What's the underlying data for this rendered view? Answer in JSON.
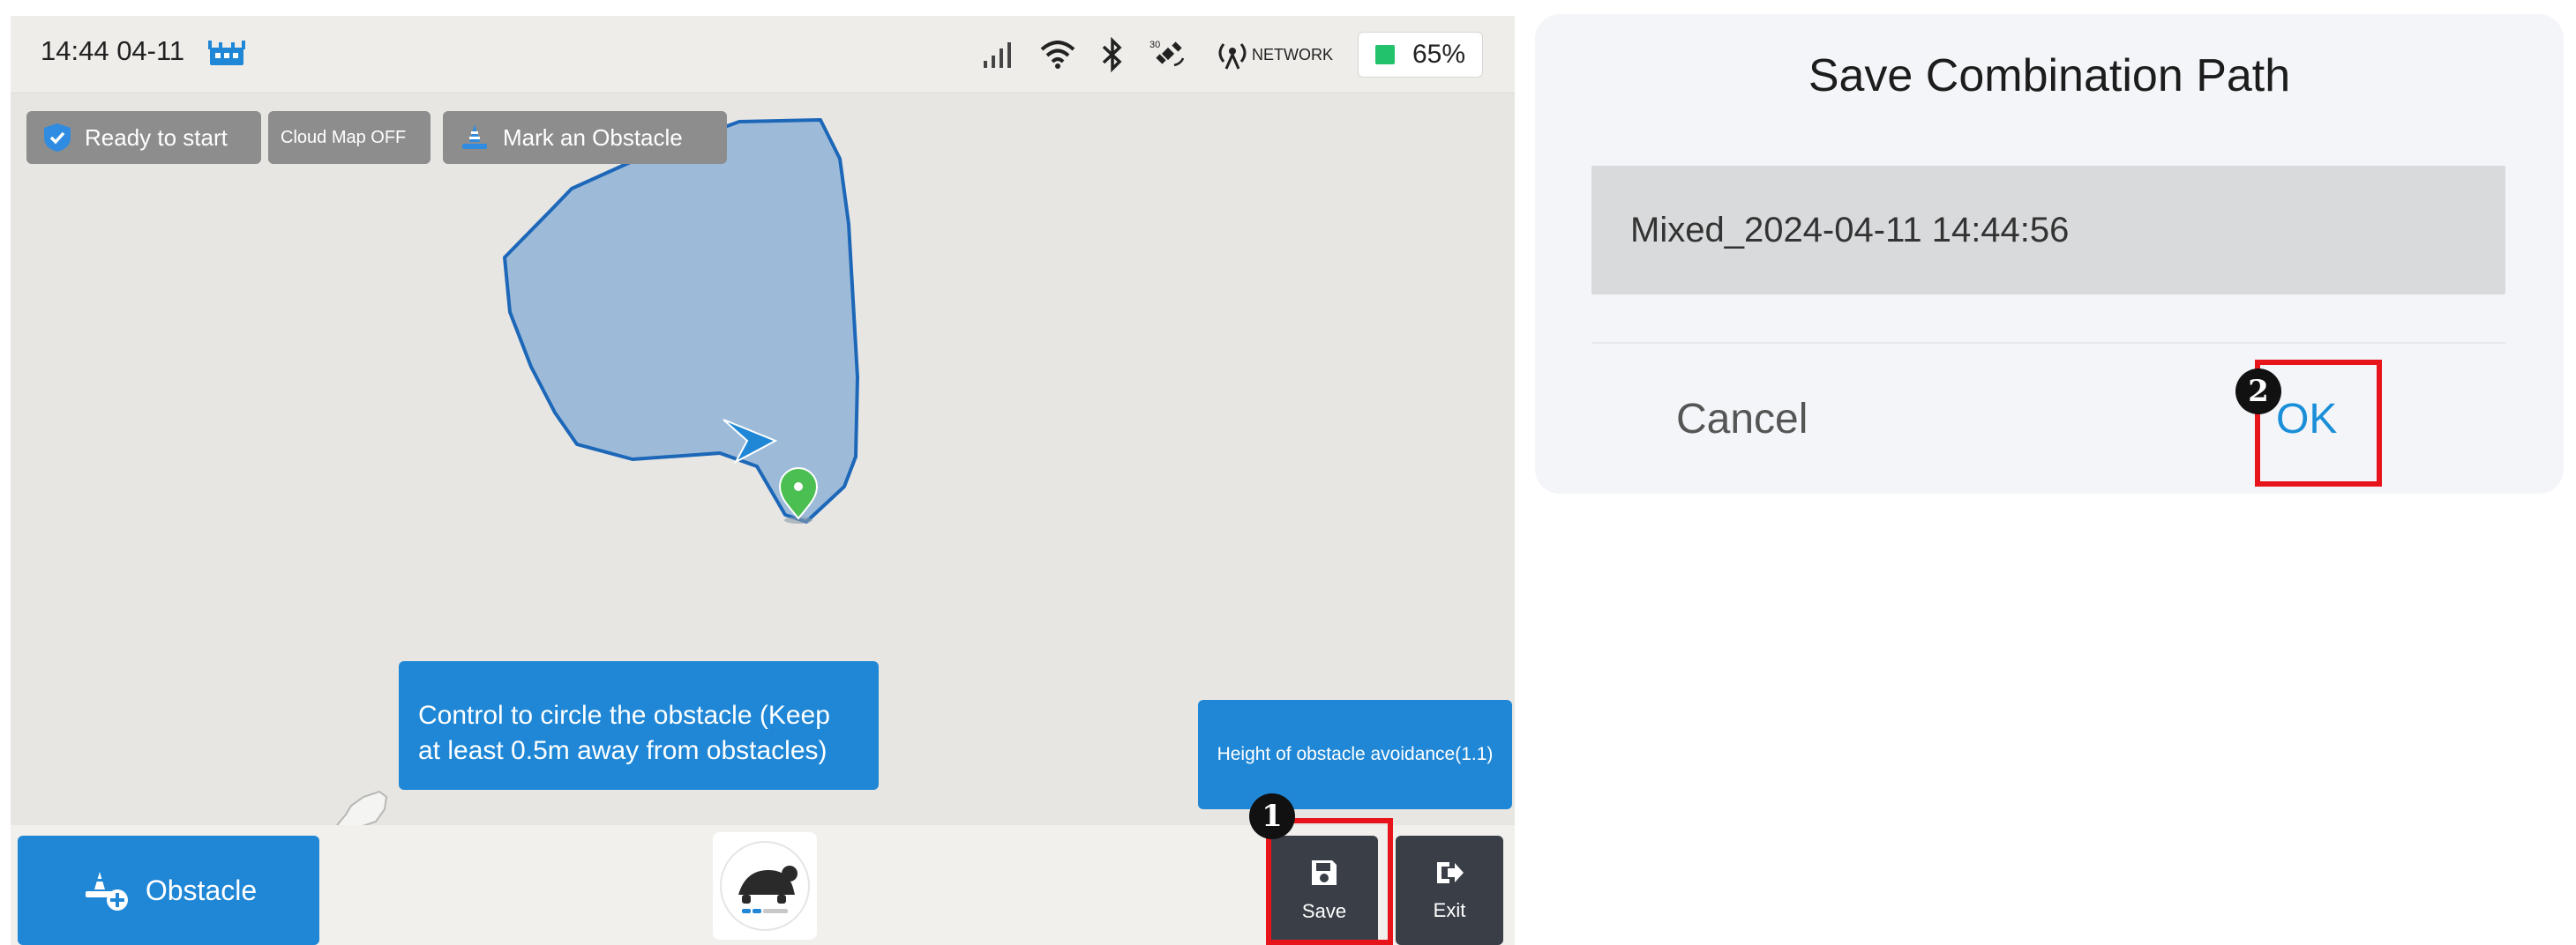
{
  "status_bar": {
    "time": "14:44 04-11",
    "network_label": "NETWORK",
    "satellite_count": "30",
    "battery_percent": "65%"
  },
  "chips": {
    "ready": "Ready to start",
    "cloud_map": "Cloud Map OFF",
    "mark_obstacle": "Mark an Obstacle"
  },
  "tooltip": {
    "text": "Control to circle the obstacle (Keep at least 0.5m away from obstacles)"
  },
  "height_avoidance": {
    "text": "Height of obstacle avoidance(1.1)"
  },
  "bottom_bar": {
    "obstacle_label": "Obstacle",
    "save_label": "Save",
    "exit_label": "Exit"
  },
  "annotations": {
    "step1": "1",
    "step2": "2"
  },
  "dialog": {
    "title": "Save Combination Path",
    "path_value": "Mixed_2024-04-11 14:44:56",
    "cancel_label": "Cancel",
    "ok_label": "OK"
  },
  "colors": {
    "accent_blue": "#1f87d6",
    "annotation_red": "#e8141c",
    "obstacle_fill": "#9dbbd8",
    "obstacle_stroke": "#1d67b9",
    "home_pin": "#4cbf52"
  }
}
